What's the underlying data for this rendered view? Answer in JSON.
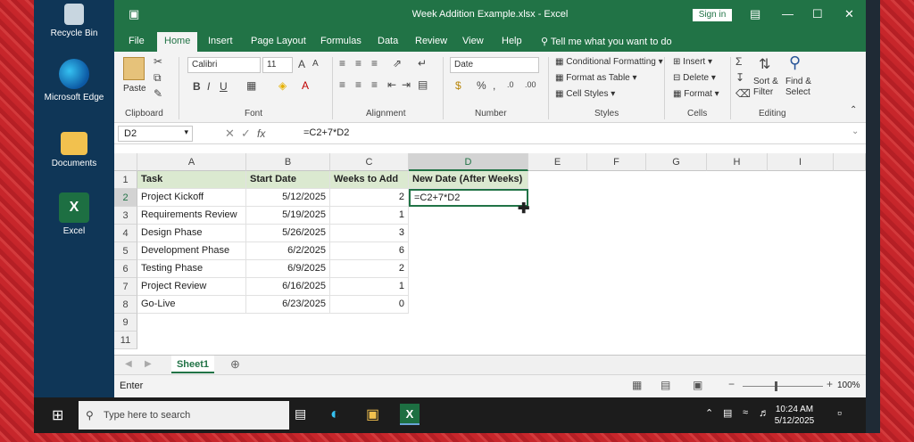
{
  "desktop": {
    "icons": [
      {
        "label": "Recycle Bin"
      },
      {
        "label": "Microsoft Edge"
      },
      {
        "label": "Documents"
      },
      {
        "label": "Excel"
      }
    ]
  },
  "window": {
    "title": "Week Addition Example.xlsx - Excel",
    "sign_in": "Sign in"
  },
  "menu": {
    "items": [
      "File",
      "Home",
      "Insert",
      "Page Layout",
      "Formulas",
      "Data",
      "Review",
      "View",
      "Help"
    ],
    "active": "Home",
    "tell_me": "Tell me what you want to do"
  },
  "ribbon": {
    "clipboard": {
      "paste": "Paste",
      "label": "Clipboard"
    },
    "font": {
      "name": "Calibri",
      "size": "11",
      "label": "Font"
    },
    "alignment": {
      "label": "Alignment"
    },
    "number": {
      "format": "Date",
      "label": "Number"
    },
    "styles": {
      "conditional": "Conditional Formatting",
      "format_table": "Format as Table",
      "cell_styles": "Cell Styles",
      "label": "Styles"
    },
    "cells": {
      "insert": "Insert",
      "delete": "Delete",
      "format": "Format",
      "label": "Cells"
    },
    "editing": {
      "sort_filter": "Sort & Filter",
      "find_select": "Find & Select",
      "label": "Editing"
    }
  },
  "formula_bar": {
    "name_box": "D2",
    "formula": "=C2+7*D2"
  },
  "grid": {
    "columns": [
      "A",
      "B",
      "C",
      "D",
      "E",
      "F",
      "G",
      "H",
      "I"
    ],
    "rows": [
      "1",
      "2",
      "3",
      "4",
      "5",
      "6",
      "7",
      "8",
      "9",
      "11"
    ],
    "header": [
      "Task",
      "Start Date",
      "Weeks to Add",
      "New Date (After Weeks)"
    ],
    "data": [
      [
        "Project Kickoff",
        "5/12/2025",
        "2",
        "=C2+7*D2"
      ],
      [
        "Requirements Review",
        "5/19/2025",
        "1",
        ""
      ],
      [
        "Design Phase",
        "5/26/2025",
        "3",
        ""
      ],
      [
        "Development Phase",
        "6/2/2025",
        "6",
        ""
      ],
      [
        "Testing Phase",
        "6/9/2025",
        "2",
        ""
      ],
      [
        "Project Review",
        "6/16/2025",
        "1",
        ""
      ],
      [
        "Go-Live",
        "6/23/2025",
        "0",
        ""
      ]
    ]
  },
  "sheet": {
    "tab": "Sheet1"
  },
  "status": {
    "mode": "Enter",
    "zoom": "100%"
  },
  "taskbar": {
    "search_placeholder": "Type here to search",
    "time": "10:24 AM",
    "date": "5/12/2025"
  },
  "colors": {
    "excel_green": "#217346",
    "header_fill": "#dbe9d0"
  }
}
